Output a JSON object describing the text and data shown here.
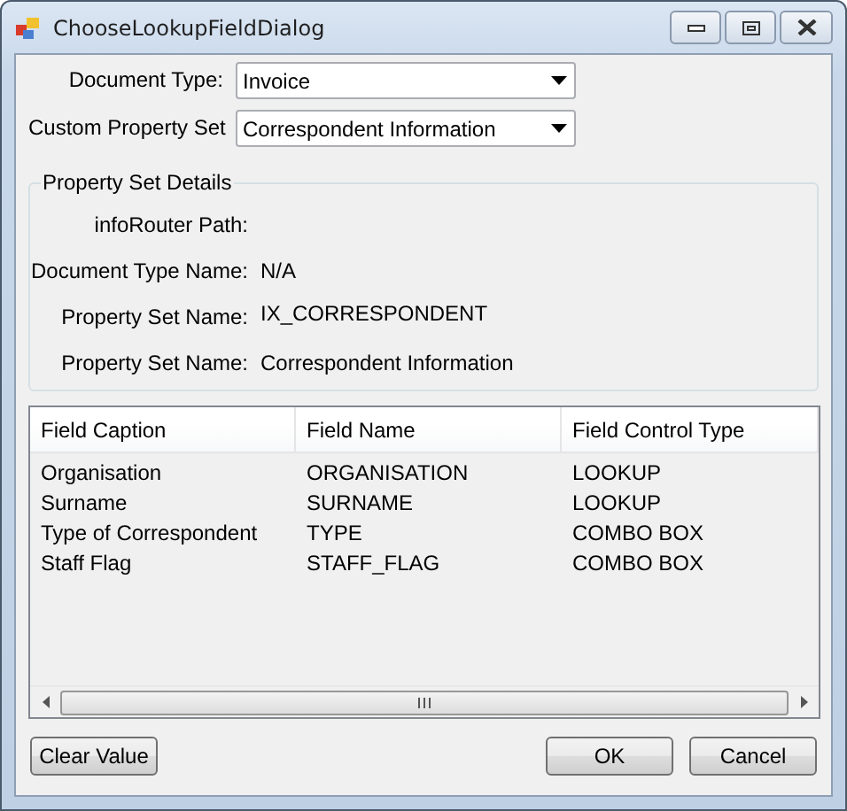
{
  "window": {
    "title": "ChooseLookupFieldDialog"
  },
  "fields": [
    {
      "label": "Document Type:",
      "value": "Invoice"
    },
    {
      "label": "Custom Property Set",
      "value": "Correspondent Information"
    }
  ],
  "property_set_details": {
    "title": "Property Set Details",
    "rows": [
      {
        "label": "infoRouter Path:",
        "value": null
      },
      {
        "label": "Document Type Name:",
        "value": "N/A"
      },
      {
        "label": "Property Set Name:",
        "value": "IX_CORRESPONDENT"
      },
      {
        "label": "Property Set Name:",
        "value": "Correspondent Information"
      }
    ]
  },
  "table": {
    "columns": [
      "Field Caption",
      "Field Name",
      "Field Control Type"
    ],
    "rows": [
      [
        "Organisation",
        "ORGANISATION",
        "LOOKUP"
      ],
      [
        "Surname",
        "SURNAME",
        "LOOKUP"
      ],
      [
        "Type of Correspondent",
        "TYPE",
        "COMBO BOX"
      ],
      [
        "Staff Flag",
        "STAFF_FLAG",
        "COMBO BOX"
      ]
    ]
  },
  "buttons": [
    {
      "label": "Clear Value",
      "kind": "left"
    },
    {
      "label": "OK",
      "kind": "right"
    },
    {
      "label": "Cancel",
      "kind": "right"
    }
  ]
}
